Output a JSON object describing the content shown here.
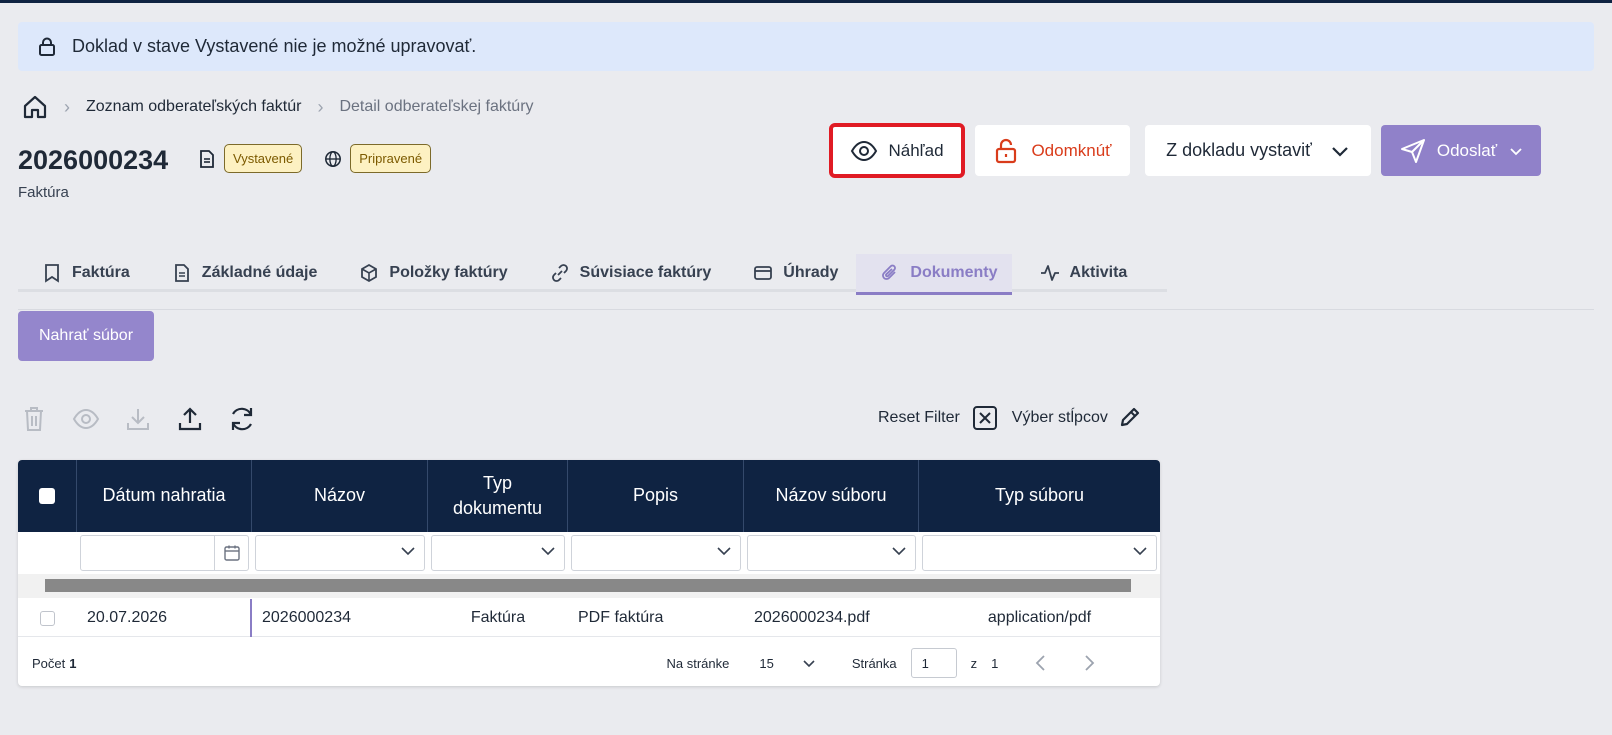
{
  "alert": {
    "text": "Doklad v stave Vystavené nie je možné upravovať."
  },
  "breadcrumb": {
    "items": [
      "Zoznam odberateľských faktúr",
      "Detail odberateľskej faktúry"
    ]
  },
  "document": {
    "number": "2026000234",
    "type": "Faktúra",
    "status_doc": "Vystavené",
    "status_web": "Pripravené"
  },
  "actions": {
    "preview": "Náhľad",
    "unlock": "Odomknúť",
    "issue_from": "Z dokladu vystaviť",
    "send": "Odoslať"
  },
  "tabs": [
    {
      "label": "Faktúra",
      "icon": "bookmark-icon"
    },
    {
      "label": "Základné údaje",
      "icon": "document-icon"
    },
    {
      "label": "Položky faktúry",
      "icon": "box-icon"
    },
    {
      "label": "Súvisiace faktúry",
      "icon": "link-icon"
    },
    {
      "label": "Úhrady",
      "icon": "card-icon"
    },
    {
      "label": "Dokumenty",
      "icon": "paperclip-icon",
      "active": true
    },
    {
      "label": "Aktivita",
      "icon": "activity-icon"
    }
  ],
  "upload": {
    "label": "Nahrať súbor"
  },
  "toolbar": {
    "reset_filter": "Reset Filter",
    "column_select": "Výber stĺpcov"
  },
  "table": {
    "columns": [
      "Dátum nahratia",
      "Názov",
      "Typ dokumentu",
      "Popis",
      "Názov súboru",
      "Typ súboru"
    ],
    "rows": [
      {
        "date": "20.07.2026",
        "name": "2026000234",
        "doc_type": "Faktúra",
        "description": "PDF faktúra",
        "file_name": "2026000234.pdf",
        "file_type": "application/pdf"
      }
    ],
    "footer": {
      "count_label": "Počet",
      "count": "1",
      "per_page_label": "Na stránke",
      "per_page": "15",
      "page_label": "Stránka",
      "page": "1",
      "of_label": "z",
      "total_pages": "1"
    }
  },
  "colors": {
    "navy": "#0f2342",
    "accent_purple": "#9081c9",
    "unlock_red": "#d93c1b",
    "highlight_red": "#e01b24",
    "alert_bg": "#dde8fb",
    "badge_bg": "#fdf1c2"
  }
}
